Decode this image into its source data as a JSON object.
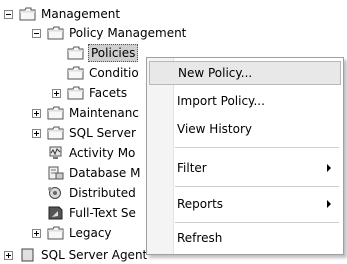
{
  "tree": {
    "management": "Management",
    "policy_management": "Policy Management",
    "policies": "Policies",
    "conditions": "Conditio",
    "facets": "Facets",
    "maintenance": "Maintenanc",
    "sql_server_logs": "SQL Server",
    "activity_monitor": "Activity Mo",
    "database_mail": "Database M",
    "distributed": "Distributed",
    "fulltext": "Full-Text Se",
    "legacy": "Legacy",
    "sql_server_agent": "SQL Server Agent"
  },
  "context_menu": {
    "new_policy": "New Policy...",
    "import_policy": "Import Policy...",
    "view_history": "View History",
    "filter": "Filter",
    "reports": "Reports",
    "refresh": "Refresh"
  }
}
